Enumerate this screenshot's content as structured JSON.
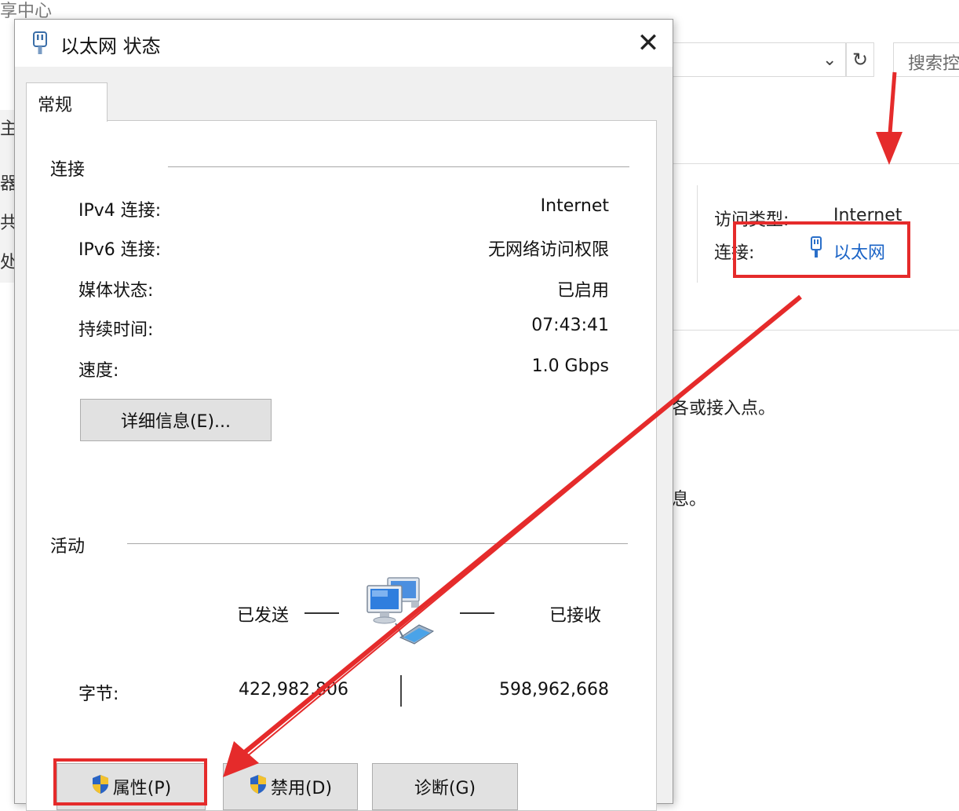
{
  "background": {
    "title_fragment": "享中心",
    "dropdown_icon": "chevron-down-icon",
    "refresh_icon": "refresh-icon",
    "search_placeholder": "搜索控",
    "sidebar_fragments": [
      "主",
      "器",
      "共",
      "处"
    ],
    "access_type_label": "访问类型:",
    "access_type_value": "Internet",
    "connection_label": "连接:",
    "connection_link": "以太网",
    "text_fragment_1": "各或接入点。",
    "text_fragment_2": "息。"
  },
  "dialog": {
    "title": "以太网 状态",
    "close_icon": "close-icon",
    "tab_general": "常规",
    "connection": {
      "section_title": "连接",
      "rows": [
        {
          "label": "IPv4 连接:",
          "value": "Internet"
        },
        {
          "label": "IPv6 连接:",
          "value": "无网络访问权限"
        },
        {
          "label": "媒体状态:",
          "value": "已启用"
        },
        {
          "label": "持续时间:",
          "value": "07:43:41"
        },
        {
          "label": "速度:",
          "value": "1.0 Gbps"
        }
      ],
      "details_button": "详细信息(E)..."
    },
    "activity": {
      "section_title": "活动",
      "sent_label": "已发送",
      "received_label": "已接收",
      "bytes_label": "字节:",
      "bytes_sent": "422,982,806",
      "bytes_received": "598,962,668"
    },
    "buttons": {
      "properties": "属性(P)",
      "disable": "禁用(D)",
      "diagnose": "诊断(G)"
    }
  },
  "annotation_color": "#e52b2b"
}
